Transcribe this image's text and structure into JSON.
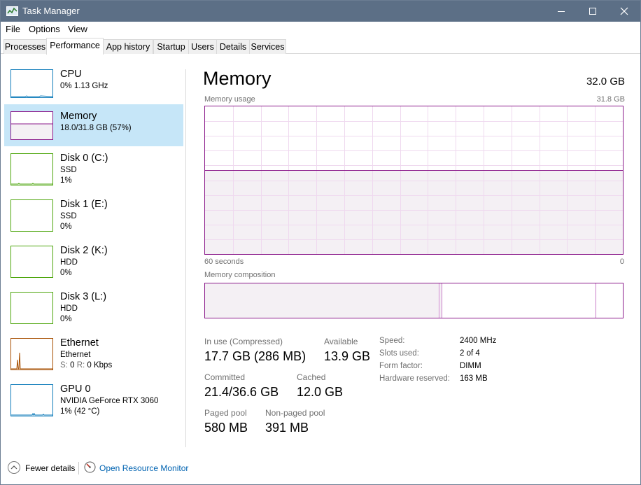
{
  "window": {
    "title": "Task Manager"
  },
  "menu": {
    "file": "File",
    "options": "Options",
    "view": "View"
  },
  "tabs": [
    {
      "label": "Processes"
    },
    {
      "label": "Performance"
    },
    {
      "label": "App history"
    },
    {
      "label": "Startup"
    },
    {
      "label": "Users"
    },
    {
      "label": "Details"
    },
    {
      "label": "Services"
    }
  ],
  "sidebar": {
    "items": [
      {
        "title": "CPU",
        "sub1": "0% 1.13 GHz"
      },
      {
        "title": "Memory",
        "sub1": "18.0/31.8 GB (57%)"
      },
      {
        "title": "Disk 0 (C:)",
        "sub1": "SSD",
        "sub2": "1%"
      },
      {
        "title": "Disk 1 (E:)",
        "sub1": "SSD",
        "sub2": "0%"
      },
      {
        "title": "Disk 2 (K:)",
        "sub1": "HDD",
        "sub2": "0%"
      },
      {
        "title": "Disk 3 (L:)",
        "sub1": "HDD",
        "sub2": "0%"
      },
      {
        "title": "Ethernet",
        "sub1": "Ethernet",
        "sub2_s": "S:",
        "sub2_s_val": "0",
        "sub2_r": "R:",
        "sub2_r_val": "0 Kbps"
      },
      {
        "title": "GPU 0",
        "sub1": "NVIDIA GeForce RTX 3060",
        "sub2": "1% (42 °C)"
      }
    ]
  },
  "main": {
    "title": "Memory",
    "total": "32.0 GB",
    "usage_label": "Memory usage",
    "usage_max": "31.8 GB",
    "axis_left": "60 seconds",
    "axis_right": "0",
    "usage_fraction": 0.57,
    "composition_label": "Memory composition",
    "stats": {
      "in_use_label": "In use (Compressed)",
      "in_use_value": "17.7 GB (286 MB)",
      "available_label": "Available",
      "available_value": "13.9 GB",
      "committed_label": "Committed",
      "committed_value": "21.4/36.6 GB",
      "cached_label": "Cached",
      "cached_value": "12.0 GB",
      "paged_label": "Paged pool",
      "paged_value": "580 MB",
      "nonpaged_label": "Non-paged pool",
      "nonpaged_value": "391 MB"
    },
    "details": {
      "speed_label": "Speed:",
      "speed_value": "2400 MHz",
      "slots_label": "Slots used:",
      "slots_value": "2 of 4",
      "form_label": "Form factor:",
      "form_value": "DIMM",
      "reserved_label": "Hardware reserved:",
      "reserved_value": "163 MB"
    }
  },
  "footer": {
    "fewer_details": "Fewer details",
    "resource_monitor": "Open Resource Monitor"
  },
  "colors": {
    "memory": "#8b1a8b",
    "cpu": "#117dbb",
    "disk": "#4da60c",
    "ethernet": "#a74f01",
    "selected": "#c6e6f8",
    "titlebar": "#5c6f86"
  }
}
